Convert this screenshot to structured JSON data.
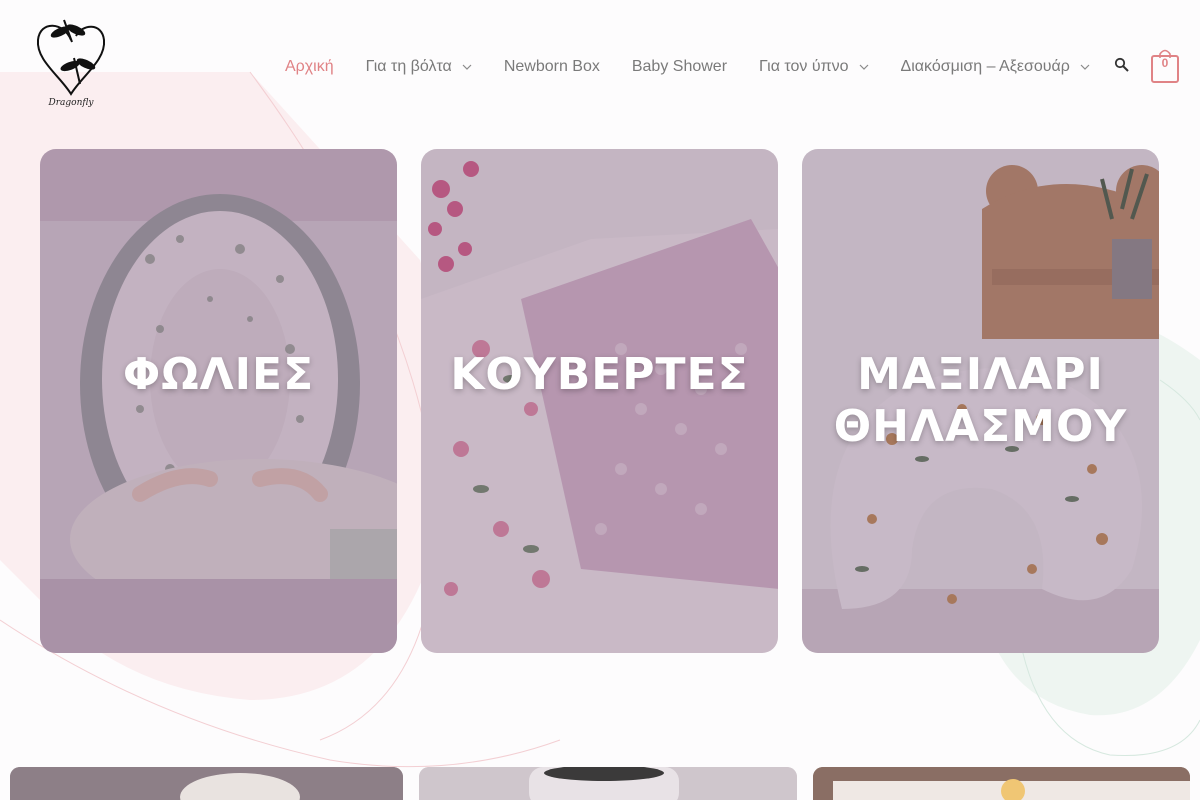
{
  "site": {
    "logo_text": "Dragonfly",
    "accent_color": "#e08386",
    "cart_count": "0"
  },
  "nav": {
    "items": [
      {
        "label": "Αρχική",
        "active": true,
        "has_submenu": false
      },
      {
        "label": "Για τη βόλτα",
        "active": false,
        "has_submenu": true
      },
      {
        "label": "Newborn Box",
        "active": false,
        "has_submenu": false
      },
      {
        "label": "Baby Shower",
        "active": false,
        "has_submenu": false
      },
      {
        "label": "Για τον ύπνο",
        "active": false,
        "has_submenu": true
      },
      {
        "label": "Διακόσμιση – Αξεσουάρ",
        "active": false,
        "has_submenu": true
      }
    ],
    "search_icon": "search-icon",
    "cart_icon": "shopping-bag-icon"
  },
  "categories": [
    {
      "title": "ΦΩΛΙΕΣ",
      "image": "baby-nest-photo"
    },
    {
      "title": "ΚΟΥΒΕΡΤΕΣ",
      "image": "blanket-photo"
    },
    {
      "title": "ΜΑΞΙΛΑΡΙ ΘΗΛΑΣΜΟΥ",
      "image": "nursing-pillow-photo"
    }
  ]
}
